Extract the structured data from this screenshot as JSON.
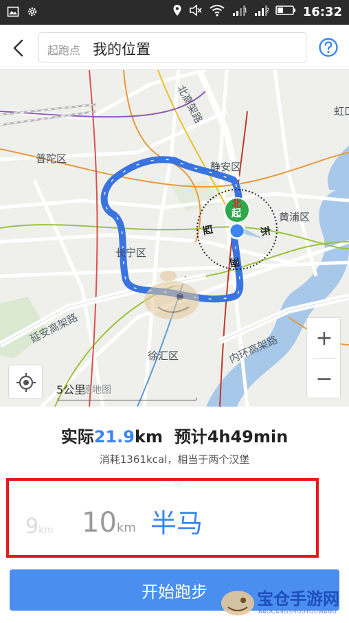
{
  "status_bar": {
    "time": "16:32",
    "left_icons": [
      "image-icon",
      "settings-icon"
    ],
    "right_icons": [
      "location-icon",
      "mute-icon",
      "wifi-icon",
      "signal-1-icon",
      "signal-2-icon",
      "battery-icon"
    ],
    "signal_labels": [
      "1",
      "2"
    ]
  },
  "header": {
    "back_icon": "chevron-left-icon",
    "start_label": "起跑点",
    "start_value": "我的位置",
    "help_icon": "help-circle-icon"
  },
  "map": {
    "district_labels": {
      "putuo": "普陀区",
      "jingan": "静安区",
      "huangpu": "黄浦区",
      "changning": "长宁区",
      "xuhui": "徐汇区",
      "hongkou": "虹口"
    },
    "road_labels": {
      "north_elevated": "北高架路",
      "yanan": "延安高架路",
      "inner_ring": "内环高架路"
    },
    "compass": {
      "north": "北",
      "east": "东",
      "south": "南",
      "west": "西",
      "start": "起"
    },
    "scale_text": "5公里",
    "map_logo": "德地图",
    "zoom_in": "+",
    "zoom_out": "−",
    "accent_color": "#3a86ee"
  },
  "summary": {
    "actual_label": "实际",
    "actual_distance": "21.9",
    "distance_unit": "km",
    "estimate_label": "预计",
    "estimate_time": "4h49min",
    "calories_text": "消耗1361kcal，相当于两个汉堡"
  },
  "picker": {
    "options": [
      {
        "value": "9",
        "unit": "km"
      },
      {
        "value": "10",
        "unit": "km"
      },
      {
        "value": "半马",
        "unit": ""
      }
    ],
    "selected": "半马"
  },
  "start_button": {
    "label": "开始跑步"
  },
  "watermark": {
    "title": "宝仓手游网",
    "subtitle": "BAOCANGSHOUYOUWANG"
  }
}
